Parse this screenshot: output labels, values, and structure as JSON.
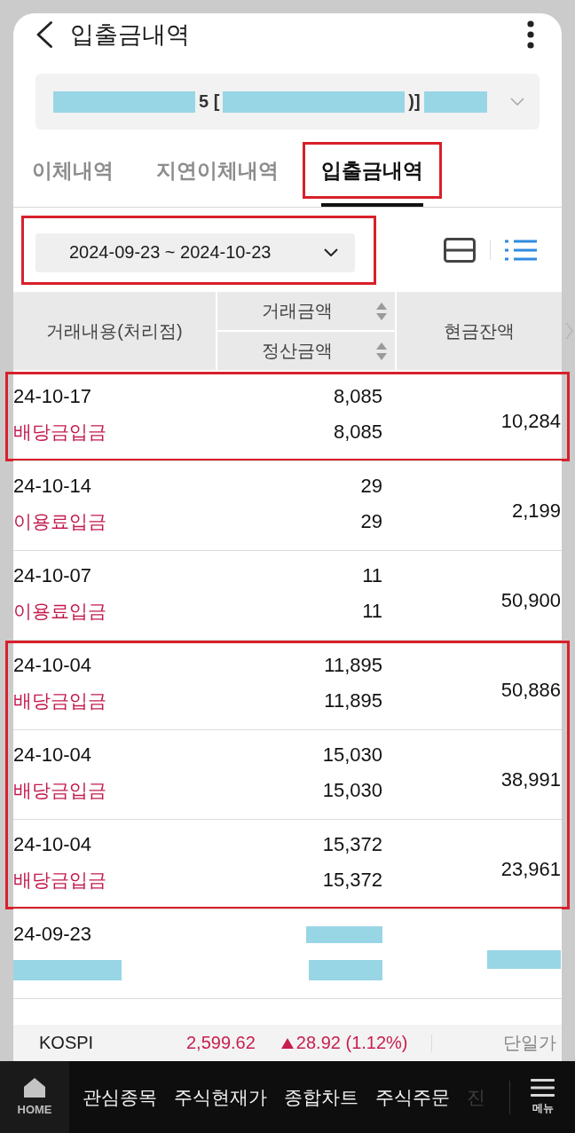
{
  "header": {
    "title": "입출금내역"
  },
  "account_selector": {
    "segments": [
      {
        "kind": "redacted"
      },
      {
        "kind": "text",
        "text": "5 ["
      },
      {
        "kind": "redacted"
      },
      {
        "kind": "text",
        "text": ")]"
      },
      {
        "kind": "redacted"
      }
    ]
  },
  "tabs": [
    {
      "label": "이체내역",
      "selected": false,
      "highlighted": false
    },
    {
      "label": "지연이체내역",
      "selected": false,
      "highlighted": false
    },
    {
      "label": "입출금내역",
      "selected": true,
      "highlighted": true
    }
  ],
  "date_filter": {
    "range": "2024-09-23 ~ 2024-10-23",
    "highlighted": true
  },
  "view_modes": [
    {
      "kind": "split",
      "selected": false
    },
    {
      "kind": "list",
      "selected": true
    }
  ],
  "table": {
    "columns": {
      "description": "거래내용(처리점)",
      "amount": "거래금액",
      "settlement": "정산금액",
      "balance": "현금잔액"
    },
    "row_groups": [
      {
        "highlighted": true,
        "rows": [
          {
            "kind": "entry",
            "date": "24-10-17",
            "type": "배당금입금",
            "amount": "8,085",
            "settlement": "8,085",
            "balance": "10,284"
          }
        ]
      },
      {
        "highlighted": false,
        "rows": [
          {
            "kind": "entry",
            "date": "24-10-14",
            "type": "이용료입금",
            "amount": "29",
            "settlement": "29",
            "balance": "2,199"
          },
          {
            "kind": "entry",
            "date": "24-10-07",
            "type": "이용료입금",
            "amount": "11",
            "settlement": "11",
            "balance": "50,900"
          }
        ]
      },
      {
        "highlighted": true,
        "rows": [
          {
            "kind": "entry",
            "date": "24-10-04",
            "type": "배당금입금",
            "amount": "11,895",
            "settlement": "11,895",
            "balance": "50,886"
          },
          {
            "kind": "entry",
            "date": "24-10-04",
            "type": "배당금입금",
            "amount": "15,030",
            "settlement": "15,030",
            "balance": "38,991"
          },
          {
            "kind": "entry",
            "date": "24-10-04",
            "type": "배당금입금",
            "amount": "15,372",
            "settlement": "15,372",
            "balance": "23,961"
          }
        ]
      },
      {
        "highlighted": false,
        "rows": [
          {
            "kind": "redacted",
            "date": "24-09-23"
          }
        ]
      }
    ]
  },
  "market_ticker": {
    "index": "KOSPI",
    "value": "2,599.62",
    "rising": true,
    "change": "28.92 (1.12%)",
    "session": "단일가"
  },
  "bottom_nav": {
    "home": "HOME",
    "items": [
      {
        "label": "관심종목",
        "faded": false
      },
      {
        "label": "주식현재가",
        "faded": false
      },
      {
        "label": "종합차트",
        "faded": false
      },
      {
        "label": "주식주문",
        "faded": false
      },
      {
        "label": "진",
        "faded": true
      }
    ],
    "menu": "메뉴"
  }
}
